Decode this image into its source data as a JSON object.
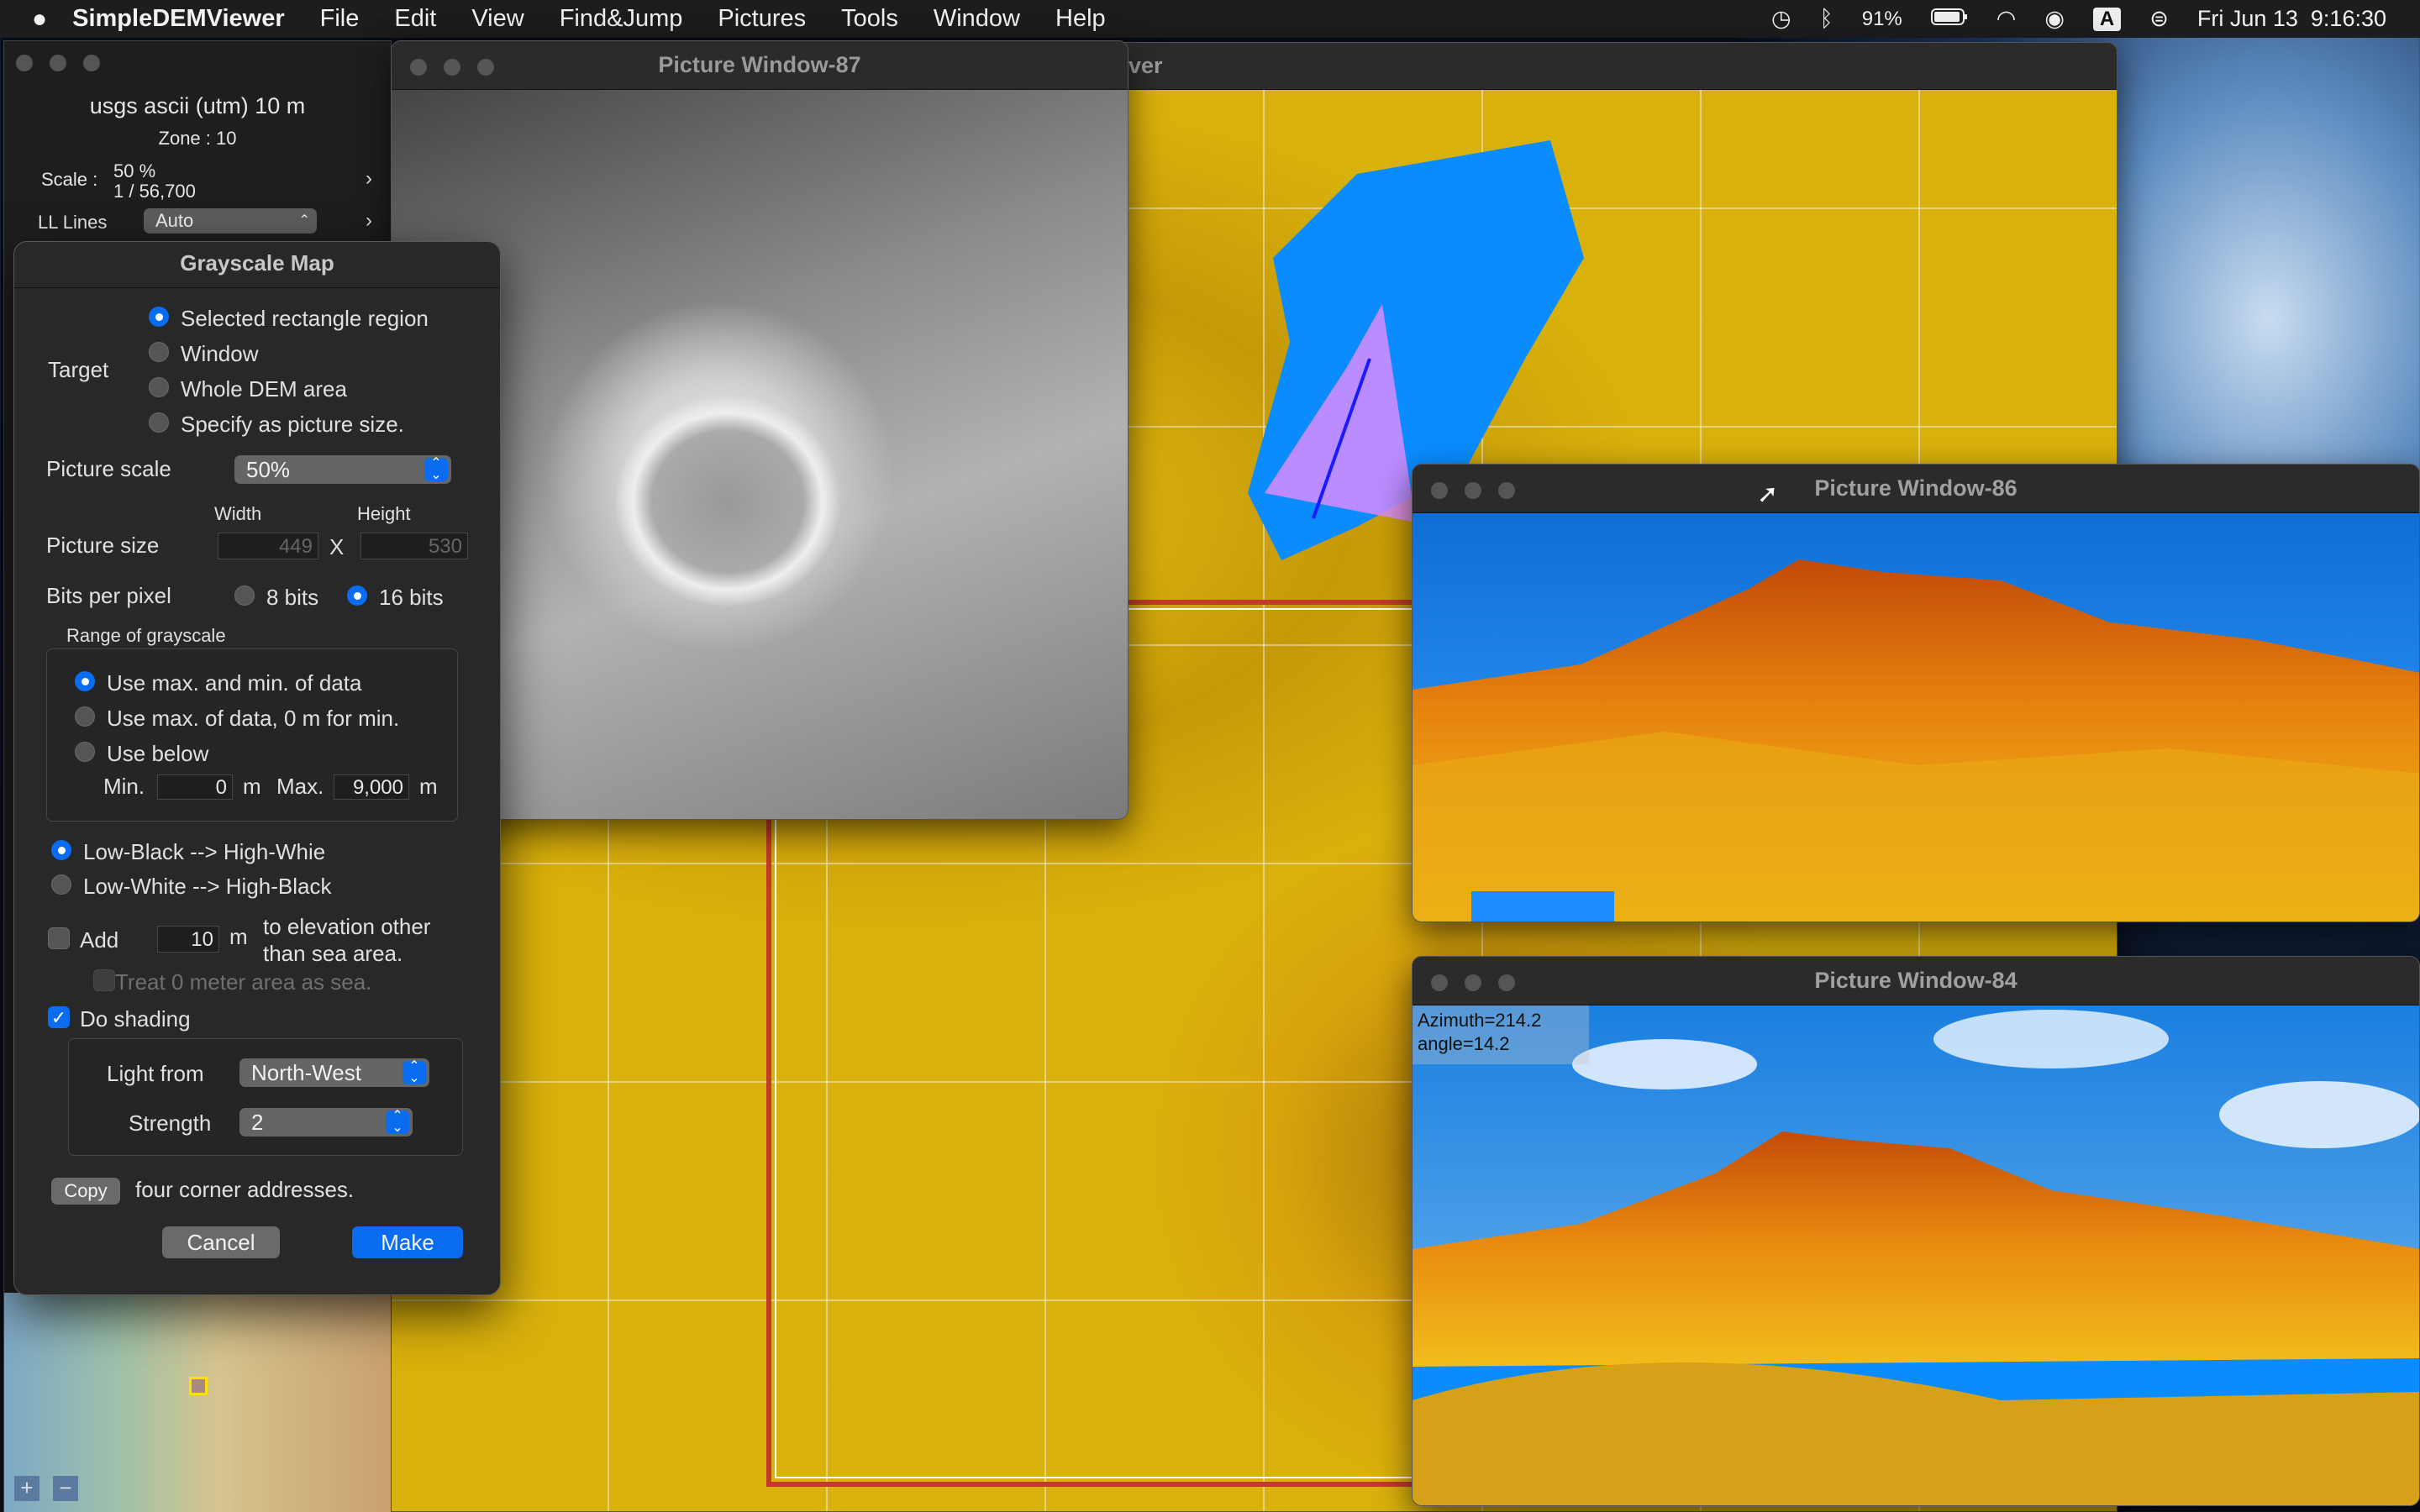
{
  "menubar": {
    "app": "SimpleDEMViewer",
    "items": [
      "File",
      "Edit",
      "View",
      "Find&Jump",
      "Pictures",
      "Tools",
      "Window",
      "Help"
    ],
    "battery": "91%",
    "input_source": "A",
    "datetime": "Fri Jun 13  9:16:30"
  },
  "main_window": {
    "title_fragment": "ver"
  },
  "side_panel": {
    "source": "usgs ascii (utm) 10 m",
    "zone": "Zone : 10",
    "scale_label": "Scale",
    "scale_pct": "50 %",
    "scale_ratio": "1 / 56,700",
    "ll_label": "LL Lines",
    "ll_value": "Auto"
  },
  "dialog": {
    "title": "Grayscale Map",
    "target_label": "Target",
    "targets": [
      "Selected rectangle region",
      "Window",
      "Whole DEM area",
      "Specify as picture size."
    ],
    "picture_scale_label": "Picture scale",
    "picture_scale_value": "50%",
    "width_label": "Width",
    "height_label": "Height",
    "picture_size_label": "Picture size",
    "width_value": "449",
    "x_label": "X",
    "height_value": "530",
    "bpp_label": "Bits per pixel",
    "bpp_8": "8 bits",
    "bpp_16": "16 bits",
    "range_label": "Range of grayscale",
    "range_opts": [
      "Use max. and min. of data",
      "Use max. of data, 0 m for min.",
      "Use below"
    ],
    "min_label": "Min.",
    "min_value": "0",
    "max_label": "Max.",
    "max_value": "9,000",
    "unit_m": "m",
    "low_black": "Low-Black --> High-Whie",
    "low_white": "Low-White --> High-Black",
    "add_label": "Add",
    "add_value": "10",
    "add_desc1": "to elevation other",
    "add_desc2": "than sea area.",
    "treat_sea": "Treat 0 meter area as sea.",
    "shading_label": "Do shading",
    "light_from_label": "Light from",
    "light_from_value": "North-West",
    "strength_label": "Strength",
    "strength_value": "2",
    "copy_btn": "Copy",
    "copy_desc": "four corner addresses.",
    "cancel_btn": "Cancel",
    "make_btn": "Make"
  },
  "pw87": {
    "title": "Picture Window-87"
  },
  "pw86": {
    "title": "Picture Window-86"
  },
  "pw84": {
    "title": "Picture Window-84",
    "azimuth": "Azimuth=214.2",
    "angle": "angle=14.2"
  },
  "colors": {
    "accent": "#0a6cf0",
    "sea": "#0a8cff",
    "terrain": "#e6b30b"
  }
}
